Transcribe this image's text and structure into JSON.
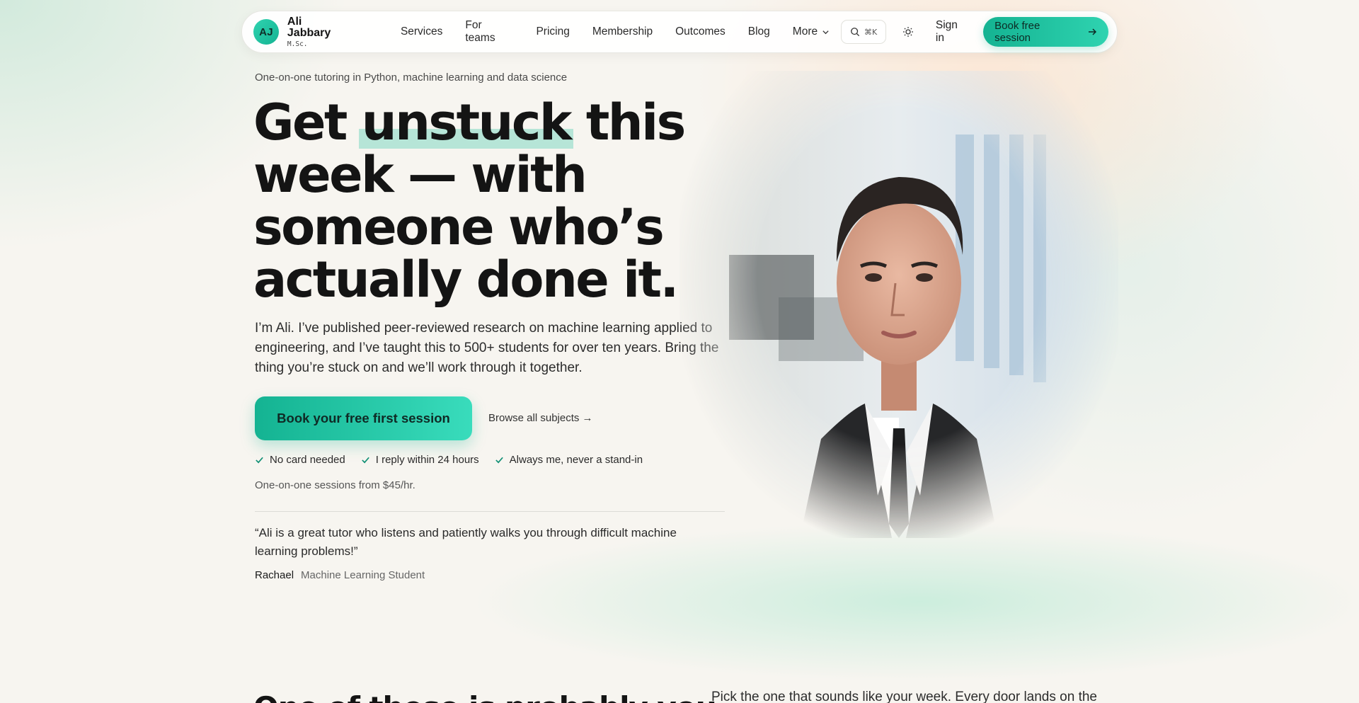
{
  "nav": {
    "logo_initials": "AJ",
    "brand_name": "Ali Jabbary",
    "brand_sub": "M.Sc.",
    "links": [
      "Services",
      "For teams",
      "Pricing",
      "Membership",
      "Outcomes",
      "Blog",
      "More"
    ],
    "search_shortcut": "⌘K",
    "sign_in": "Sign in",
    "cta": "Book free session"
  },
  "hero": {
    "eyebrow": "One-on-one tutoring in Python, machine learning and data science",
    "headline": {
      "l1_pre": "Get ",
      "l1_mark": "unstuck",
      "l1_post": " this",
      "l2": "week — with",
      "l3": "someone who’s",
      "l4": "actually done it."
    },
    "lede": "I’m Ali. I’ve published peer-reviewed research on machine learning applied to engineering, and I’ve taught this to 500+ students for over ten years. Bring the thing you’re stuck on and we’ll work through it together.",
    "cta_primary": "Book your free first session",
    "cta_secondary": "Browse all subjects →",
    "checks": [
      "No card needed",
      "I reply within 24 hours",
      "Always me, never a stand-in"
    ],
    "price_note": "One-on-one sessions from $45/hr.",
    "testimonial": {
      "quote": "“Ali is a great tutor who listens and patiently walks you through difficult machine learning problems!”",
      "name": "Rachael",
      "role": "Machine Learning Student"
    }
  },
  "next_section": {
    "heading_peek": "One of these is probably you",
    "text_peek": "Pick the one that sounds like your week. Every door lands on the"
  },
  "colors": {
    "accent": "#14b392",
    "accent_light": "#2fd3b0",
    "background": "#f7f5f0",
    "text": "#141414"
  }
}
